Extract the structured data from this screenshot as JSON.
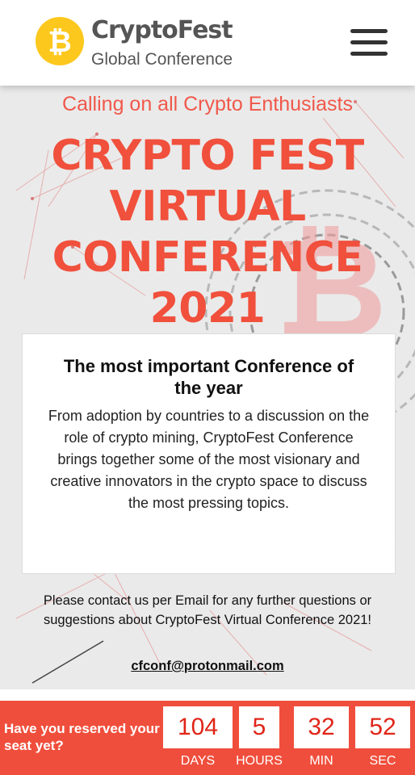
{
  "header": {
    "logo_icon": "bitcoin-icon",
    "logo_symbol": "₿",
    "brand_name": "CryptoFest",
    "brand_subtitle": "Global Conference",
    "menu_icon": "hamburger-menu-icon"
  },
  "hero": {
    "tagline": "Calling on all Crypto Enthusiasts",
    "title_lines": [
      "CRYPTO FEST",
      "VIRTUAL",
      "CONFERENCE",
      "2021"
    ],
    "background_icon": "bitcoin-watermark-icon"
  },
  "card": {
    "title": "The most important Conference of the year",
    "text": "From adoption by countries to a discussion on the role of crypto mining, CryptoFest Conference brings together some of the most visionary and creative innovators in the crypto space to discuss the most pressing topics."
  },
  "contact": {
    "text": "Please contact us per Email for any further questions or suggestions about CryptoFest Virtual Conference 2021!",
    "email": "cfconf@protonmail.com"
  },
  "countdown": {
    "question": "Have you reserved your seat yet?",
    "days": {
      "value": "104",
      "label": "DAYS"
    },
    "hours": {
      "value": "5",
      "label": "HOURS"
    },
    "minutes": {
      "value": "32",
      "label": "MIN"
    },
    "seconds": {
      "value": "52",
      "label": "SEC"
    }
  },
  "colors": {
    "accent": "#f0503c",
    "coin": "#fcc81e",
    "countdown_bg": "#f04e3c",
    "countdown_digits": "#e02518"
  }
}
